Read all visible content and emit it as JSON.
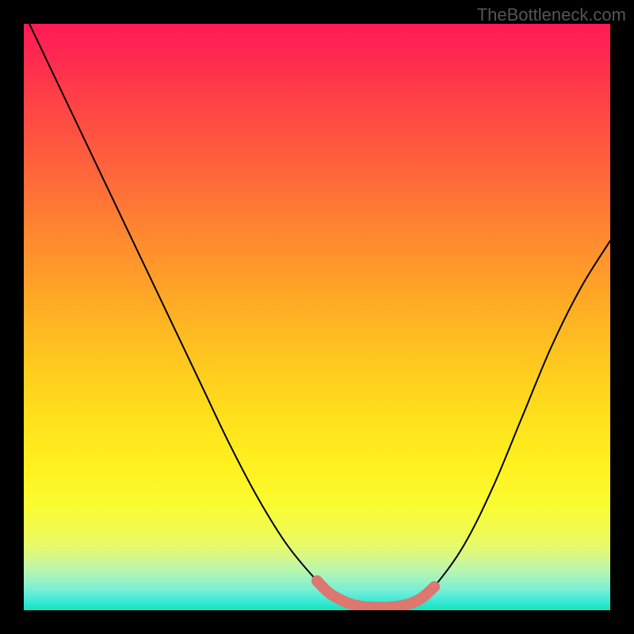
{
  "watermark": "TheBottleneck.com",
  "chart_data": {
    "type": "line",
    "title": "",
    "xlabel": "",
    "ylabel": "",
    "xlim": [
      0,
      100
    ],
    "ylim": [
      0,
      100
    ],
    "grid": false,
    "series": [
      {
        "name": "bottleneck-curve",
        "color": "#000000",
        "x": [
          0,
          5,
          10,
          15,
          20,
          25,
          30,
          35,
          40,
          45,
          50,
          52,
          54,
          56,
          58,
          60,
          62,
          64,
          66,
          68,
          70,
          75,
          80,
          85,
          90,
          95,
          100
        ],
        "y": [
          102,
          91.5,
          81,
          70.5,
          60,
          49.5,
          39,
          28.5,
          19,
          11,
          5,
          3,
          1.8,
          1.0,
          0.6,
          0.5,
          0.5,
          0.7,
          1.2,
          2.2,
          4.0,
          11,
          21,
          33,
          45,
          55,
          63
        ]
      },
      {
        "name": "bottleneck-highlight",
        "color": "#dd776f",
        "x": [
          50,
          52,
          54,
          56,
          58,
          60,
          62,
          64,
          66,
          68,
          70
        ],
        "y": [
          5,
          3,
          1.8,
          1.0,
          0.6,
          0.5,
          0.5,
          0.7,
          1.2,
          2.2,
          4.0
        ]
      }
    ],
    "gradient_stops": [
      {
        "pos": 0,
        "color": "#ff1a55"
      },
      {
        "pos": 50,
        "color": "#ffb822"
      },
      {
        "pos": 80,
        "color": "#fff220"
      },
      {
        "pos": 100,
        "color": "#14e3b8"
      }
    ]
  }
}
